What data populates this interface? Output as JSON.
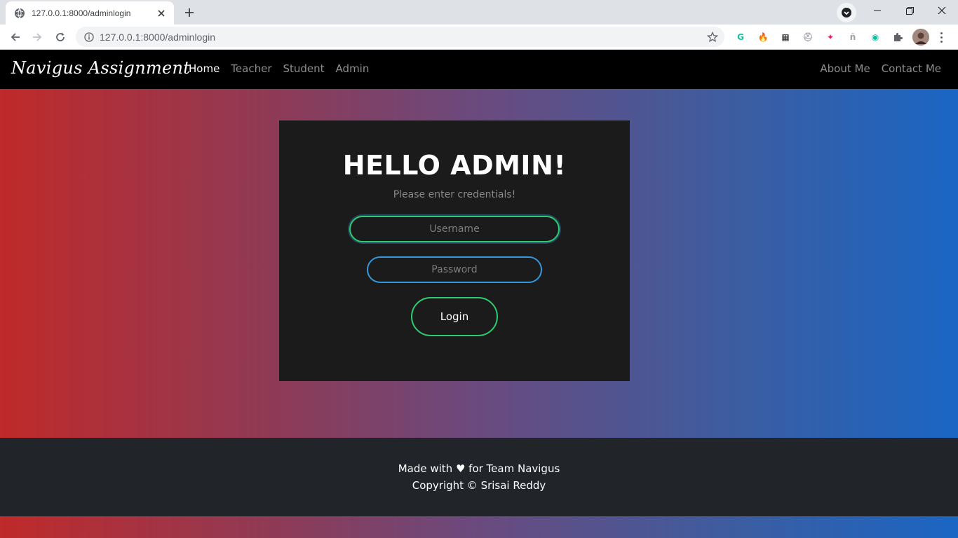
{
  "browser": {
    "tab_title": "127.0.0.1:8000/adminlogin",
    "url": "127.0.0.1:8000/adminlogin",
    "extensions": [
      {
        "name": "grammarly-icon",
        "glyph": "G",
        "color": "#15c39a"
      },
      {
        "name": "fire-icon",
        "glyph": "🔥",
        "color": "#f57c00"
      },
      {
        "name": "grid-icon",
        "glyph": "▦",
        "color": "#202124"
      },
      {
        "name": "hat-icon",
        "glyph": "⛑",
        "color": "#9aa0a6"
      },
      {
        "name": "colorful-extension-icon",
        "glyph": "✦",
        "color": "#e91e63"
      },
      {
        "name": "font-extension-icon",
        "glyph": "ñ",
        "color": "#9aa0a6"
      },
      {
        "name": "teal-extension-icon",
        "glyph": "◉",
        "color": "#00bfa5"
      }
    ]
  },
  "navbar": {
    "brand": "Navigus Assignment",
    "links": [
      "Home",
      "Teacher",
      "Student",
      "Admin"
    ],
    "right_links": [
      "About Me",
      "Contact Me"
    ]
  },
  "login": {
    "title": "HELLO ADMIN!",
    "subtitle": "Please enter credentials!",
    "username_placeholder": "Username",
    "password_placeholder": "Password",
    "button": "Login"
  },
  "footer": {
    "line1": "Made with ♥ for Team Navigus",
    "line2": "Copyright © Srisai Reddy"
  }
}
